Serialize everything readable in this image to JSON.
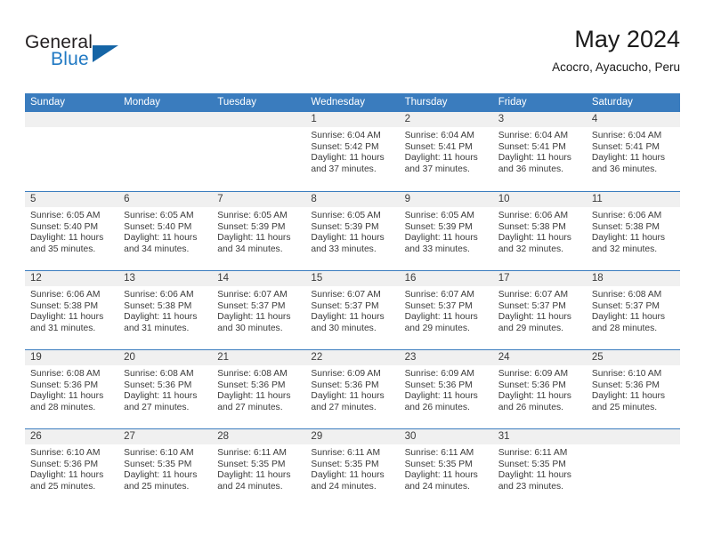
{
  "brand": {
    "name_part1": "General",
    "name_part2": "Blue",
    "flag_color": "#1565a6"
  },
  "header": {
    "title": "May 2024",
    "subtitle": "Acocro, Ayacucho, Peru"
  },
  "calendar": {
    "header_color": "#3a7cbe",
    "date_band_color": "#f0f0f0",
    "weekdays": [
      "Sunday",
      "Monday",
      "Tuesday",
      "Wednesday",
      "Thursday",
      "Friday",
      "Saturday"
    ],
    "weeks": [
      [
        {
          "date": "",
          "sunrise": "",
          "sunset": "",
          "daylight_line1": "",
          "daylight_line2": "",
          "empty": true
        },
        {
          "date": "",
          "sunrise": "",
          "sunset": "",
          "daylight_line1": "",
          "daylight_line2": "",
          "empty": true
        },
        {
          "date": "",
          "sunrise": "",
          "sunset": "",
          "daylight_line1": "",
          "daylight_line2": "",
          "empty": true
        },
        {
          "date": "1",
          "sunrise": "Sunrise: 6:04 AM",
          "sunset": "Sunset: 5:42 PM",
          "daylight_line1": "Daylight: 11 hours",
          "daylight_line2": "and 37 minutes."
        },
        {
          "date": "2",
          "sunrise": "Sunrise: 6:04 AM",
          "sunset": "Sunset: 5:41 PM",
          "daylight_line1": "Daylight: 11 hours",
          "daylight_line2": "and 37 minutes."
        },
        {
          "date": "3",
          "sunrise": "Sunrise: 6:04 AM",
          "sunset": "Sunset: 5:41 PM",
          "daylight_line1": "Daylight: 11 hours",
          "daylight_line2": "and 36 minutes."
        },
        {
          "date": "4",
          "sunrise": "Sunrise: 6:04 AM",
          "sunset": "Sunset: 5:41 PM",
          "daylight_line1": "Daylight: 11 hours",
          "daylight_line2": "and 36 minutes."
        }
      ],
      [
        {
          "date": "5",
          "sunrise": "Sunrise: 6:05 AM",
          "sunset": "Sunset: 5:40 PM",
          "daylight_line1": "Daylight: 11 hours",
          "daylight_line2": "and 35 minutes."
        },
        {
          "date": "6",
          "sunrise": "Sunrise: 6:05 AM",
          "sunset": "Sunset: 5:40 PM",
          "daylight_line1": "Daylight: 11 hours",
          "daylight_line2": "and 34 minutes."
        },
        {
          "date": "7",
          "sunrise": "Sunrise: 6:05 AM",
          "sunset": "Sunset: 5:39 PM",
          "daylight_line1": "Daylight: 11 hours",
          "daylight_line2": "and 34 minutes."
        },
        {
          "date": "8",
          "sunrise": "Sunrise: 6:05 AM",
          "sunset": "Sunset: 5:39 PM",
          "daylight_line1": "Daylight: 11 hours",
          "daylight_line2": "and 33 minutes."
        },
        {
          "date": "9",
          "sunrise": "Sunrise: 6:05 AM",
          "sunset": "Sunset: 5:39 PM",
          "daylight_line1": "Daylight: 11 hours",
          "daylight_line2": "and 33 minutes."
        },
        {
          "date": "10",
          "sunrise": "Sunrise: 6:06 AM",
          "sunset": "Sunset: 5:38 PM",
          "daylight_line1": "Daylight: 11 hours",
          "daylight_line2": "and 32 minutes."
        },
        {
          "date": "11",
          "sunrise": "Sunrise: 6:06 AM",
          "sunset": "Sunset: 5:38 PM",
          "daylight_line1": "Daylight: 11 hours",
          "daylight_line2": "and 32 minutes."
        }
      ],
      [
        {
          "date": "12",
          "sunrise": "Sunrise: 6:06 AM",
          "sunset": "Sunset: 5:38 PM",
          "daylight_line1": "Daylight: 11 hours",
          "daylight_line2": "and 31 minutes."
        },
        {
          "date": "13",
          "sunrise": "Sunrise: 6:06 AM",
          "sunset": "Sunset: 5:38 PM",
          "daylight_line1": "Daylight: 11 hours",
          "daylight_line2": "and 31 minutes."
        },
        {
          "date": "14",
          "sunrise": "Sunrise: 6:07 AM",
          "sunset": "Sunset: 5:37 PM",
          "daylight_line1": "Daylight: 11 hours",
          "daylight_line2": "and 30 minutes."
        },
        {
          "date": "15",
          "sunrise": "Sunrise: 6:07 AM",
          "sunset": "Sunset: 5:37 PM",
          "daylight_line1": "Daylight: 11 hours",
          "daylight_line2": "and 30 minutes."
        },
        {
          "date": "16",
          "sunrise": "Sunrise: 6:07 AM",
          "sunset": "Sunset: 5:37 PM",
          "daylight_line1": "Daylight: 11 hours",
          "daylight_line2": "and 29 minutes."
        },
        {
          "date": "17",
          "sunrise": "Sunrise: 6:07 AM",
          "sunset": "Sunset: 5:37 PM",
          "daylight_line1": "Daylight: 11 hours",
          "daylight_line2": "and 29 minutes."
        },
        {
          "date": "18",
          "sunrise": "Sunrise: 6:08 AM",
          "sunset": "Sunset: 5:37 PM",
          "daylight_line1": "Daylight: 11 hours",
          "daylight_line2": "and 28 minutes."
        }
      ],
      [
        {
          "date": "19",
          "sunrise": "Sunrise: 6:08 AM",
          "sunset": "Sunset: 5:36 PM",
          "daylight_line1": "Daylight: 11 hours",
          "daylight_line2": "and 28 minutes."
        },
        {
          "date": "20",
          "sunrise": "Sunrise: 6:08 AM",
          "sunset": "Sunset: 5:36 PM",
          "daylight_line1": "Daylight: 11 hours",
          "daylight_line2": "and 27 minutes."
        },
        {
          "date": "21",
          "sunrise": "Sunrise: 6:08 AM",
          "sunset": "Sunset: 5:36 PM",
          "daylight_line1": "Daylight: 11 hours",
          "daylight_line2": "and 27 minutes."
        },
        {
          "date": "22",
          "sunrise": "Sunrise: 6:09 AM",
          "sunset": "Sunset: 5:36 PM",
          "daylight_line1": "Daylight: 11 hours",
          "daylight_line2": "and 27 minutes."
        },
        {
          "date": "23",
          "sunrise": "Sunrise: 6:09 AM",
          "sunset": "Sunset: 5:36 PM",
          "daylight_line1": "Daylight: 11 hours",
          "daylight_line2": "and 26 minutes."
        },
        {
          "date": "24",
          "sunrise": "Sunrise: 6:09 AM",
          "sunset": "Sunset: 5:36 PM",
          "daylight_line1": "Daylight: 11 hours",
          "daylight_line2": "and 26 minutes."
        },
        {
          "date": "25",
          "sunrise": "Sunrise: 6:10 AM",
          "sunset": "Sunset: 5:36 PM",
          "daylight_line1": "Daylight: 11 hours",
          "daylight_line2": "and 25 minutes."
        }
      ],
      [
        {
          "date": "26",
          "sunrise": "Sunrise: 6:10 AM",
          "sunset": "Sunset: 5:36 PM",
          "daylight_line1": "Daylight: 11 hours",
          "daylight_line2": "and 25 minutes."
        },
        {
          "date": "27",
          "sunrise": "Sunrise: 6:10 AM",
          "sunset": "Sunset: 5:35 PM",
          "daylight_line1": "Daylight: 11 hours",
          "daylight_line2": "and 25 minutes."
        },
        {
          "date": "28",
          "sunrise": "Sunrise: 6:11 AM",
          "sunset": "Sunset: 5:35 PM",
          "daylight_line1": "Daylight: 11 hours",
          "daylight_line2": "and 24 minutes."
        },
        {
          "date": "29",
          "sunrise": "Sunrise: 6:11 AM",
          "sunset": "Sunset: 5:35 PM",
          "daylight_line1": "Daylight: 11 hours",
          "daylight_line2": "and 24 minutes."
        },
        {
          "date": "30",
          "sunrise": "Sunrise: 6:11 AM",
          "sunset": "Sunset: 5:35 PM",
          "daylight_line1": "Daylight: 11 hours",
          "daylight_line2": "and 24 minutes."
        },
        {
          "date": "31",
          "sunrise": "Sunrise: 6:11 AM",
          "sunset": "Sunset: 5:35 PM",
          "daylight_line1": "Daylight: 11 hours",
          "daylight_line2": "and 23 minutes."
        },
        {
          "date": "",
          "sunrise": "",
          "sunset": "",
          "daylight_line1": "",
          "daylight_line2": "",
          "empty": true
        }
      ]
    ]
  }
}
